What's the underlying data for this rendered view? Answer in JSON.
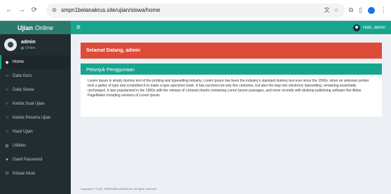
{
  "browser": {
    "url": "smpn1belanakrus.site/ujian/siswa/home",
    "site_icon": "tune-icon"
  },
  "header": {
    "logo_bold": "Ujian",
    "logo_rest": "Online",
    "user_greeting": "Halo, admin"
  },
  "sidebar": {
    "user_name": "admin",
    "user_status": "Online",
    "items": [
      {
        "label": "Home",
        "icon": "home-icon"
      },
      {
        "label": "Data Guru",
        "icon": "circle-icon"
      },
      {
        "label": "Data Siswa",
        "icon": "circle-icon"
      },
      {
        "label": "Kelola Soal Ujian",
        "icon": "circle-icon"
      },
      {
        "label": "Kelola Peserta Ujian",
        "icon": "circle-icon"
      },
      {
        "label": "Hasil Ujian",
        "icon": "circle-icon"
      },
      {
        "label": "Utilities",
        "icon": "gears-icon"
      },
      {
        "label": "Ganti Password",
        "icon": "lock-icon"
      },
      {
        "label": "Keluar Akun",
        "icon": "power-icon"
      }
    ]
  },
  "main": {
    "welcome": "Selamat Datang, admin",
    "box_title": "Petunjuk Penggunaan",
    "box_text": "Lorem Ipsum is simply dummy text of the printing and typesetting industry. Lorem Ipsum has been the industry's standard dummy text ever since the 1500s, when an unknown printer took a galley of type and scrambled it to make a type specimen book. It has survived not only five centuries, but also the leap into electronic typesetting, remaining essentially unchanged. It was popularised in the 1960s with the release of Letraset sheets containing Lorem Ipsum passages, and more recently with desktop publishing software like Aldus PageMaker including versions of Lorem Ipsum.",
    "footer": "Copyright © 2025, SMPN1BELANAKRUS. All rights reserved."
  },
  "colors": {
    "accent": "#18a58d",
    "logo": "#2c7a6c",
    "sidebar": "#222d32",
    "alert": "#dd4b39"
  }
}
